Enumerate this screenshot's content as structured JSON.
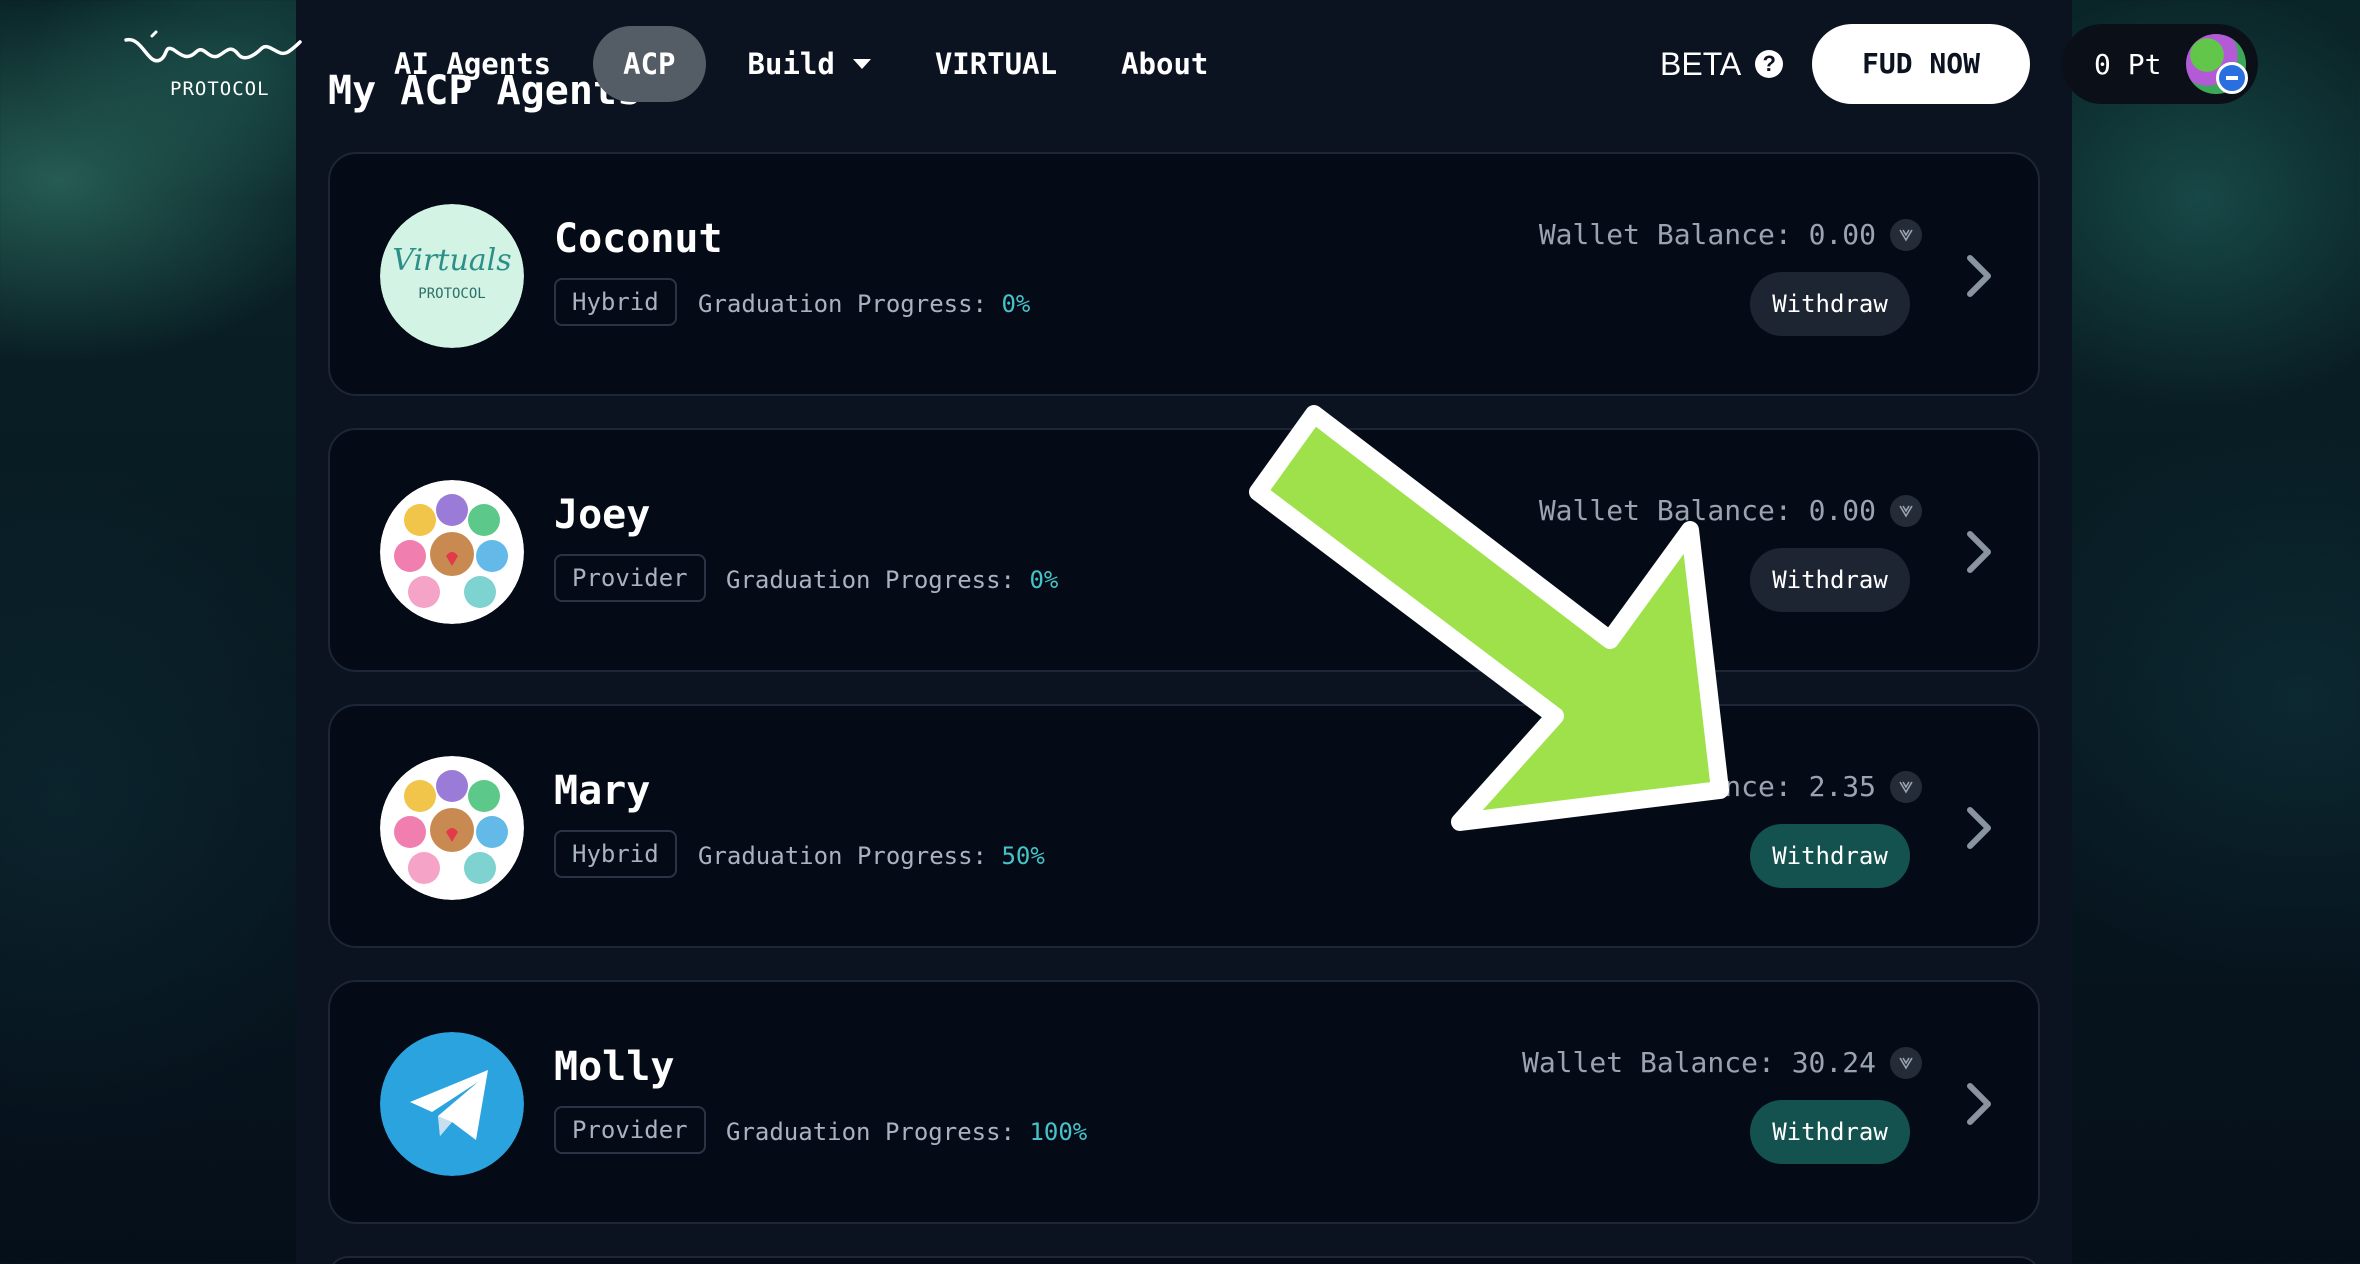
{
  "header": {
    "logo": {
      "script_text": "Virtuals",
      "subtitle": "PROTOCOL"
    },
    "nav": [
      {
        "label": "AI Agents"
      },
      {
        "label": "ACP",
        "active": true
      },
      {
        "label": "Build",
        "has_dropdown": true
      },
      {
        "label": "VIRTUAL"
      },
      {
        "label": "About"
      }
    ],
    "beta_label": "BETA",
    "help_icon": "question-circle-icon",
    "cta_label": "FUD NOW",
    "points_label": "0 Pt"
  },
  "page_title": "My ACP Agents",
  "agents": [
    {
      "name": "Coconut",
      "role": "Hybrid",
      "graduation_label": "Graduation Progress:",
      "graduation_value": "0%",
      "wallet_label": "Wallet Balance:",
      "wallet_value": "0.00",
      "withdraw_label": "Withdraw",
      "withdraw_enabled": false,
      "avatar": "virtuals-protocol-logo"
    },
    {
      "name": "Joey",
      "role": "Provider",
      "graduation_label": "Graduation Progress:",
      "graduation_value": "0%",
      "wallet_label": "Wallet Balance:",
      "wallet_value": "0.00",
      "withdraw_label": "Withdraw",
      "withdraw_enabled": false,
      "avatar": "care-bears-image"
    },
    {
      "name": "Mary",
      "role": "Hybrid",
      "graduation_label": "Graduation Progress:",
      "graduation_value": "50%",
      "wallet_label": "Wallet Balance:",
      "wallet_value": "2.35",
      "withdraw_label": "Withdraw",
      "withdraw_enabled": true,
      "avatar": "care-bears-image"
    },
    {
      "name": "Molly",
      "role": "Provider",
      "graduation_label": "Graduation Progress:",
      "graduation_value": "100%",
      "wallet_label": "Wallet Balance:",
      "wallet_value": "30.24",
      "withdraw_label": "Withdraw",
      "withdraw_enabled": true,
      "avatar": "telegram-logo"
    }
  ],
  "colors": {
    "accent_teal": "#46c2c9",
    "withdraw_enabled": "#13524f",
    "withdraw_disabled": "#1d2532",
    "annotation_arrow": "#9ee14a"
  }
}
